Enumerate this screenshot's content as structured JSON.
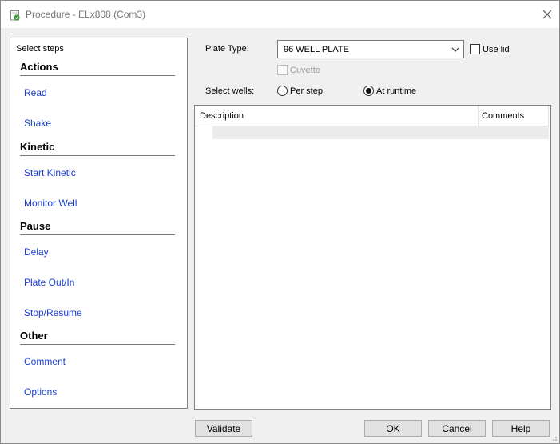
{
  "window": {
    "title": "Procedure - ELx808 (Com3)"
  },
  "steps": {
    "caption": "Select steps",
    "groups": [
      {
        "header": "Actions",
        "items": [
          "Read",
          "Shake"
        ]
      },
      {
        "header": "Kinetic",
        "items": [
          "Start Kinetic",
          "Monitor Well"
        ]
      },
      {
        "header": "Pause",
        "items": [
          "Delay",
          "Plate Out/In",
          "Stop/Resume"
        ]
      },
      {
        "header": "Other",
        "items": [
          "Comment",
          "Options"
        ]
      }
    ]
  },
  "form": {
    "plate_type_label": "Plate Type:",
    "plate_type_value": "96 WELL PLATE",
    "use_lid_label": "Use lid",
    "use_lid_checked": false,
    "cuvette_label": "Cuvette",
    "cuvette_checked": false,
    "select_wells_label": "Select wells:",
    "radio_per_step": "Per step",
    "radio_at_runtime": "At runtime",
    "selected_wells_mode": "At runtime"
  },
  "grid": {
    "columns": [
      "Description",
      "Comments"
    ]
  },
  "buttons": {
    "validate": "Validate",
    "ok": "OK",
    "cancel": "Cancel",
    "help": "Help"
  },
  "colors": {
    "link": "#1a3ed4",
    "app_icon": "#3a9a3a"
  }
}
